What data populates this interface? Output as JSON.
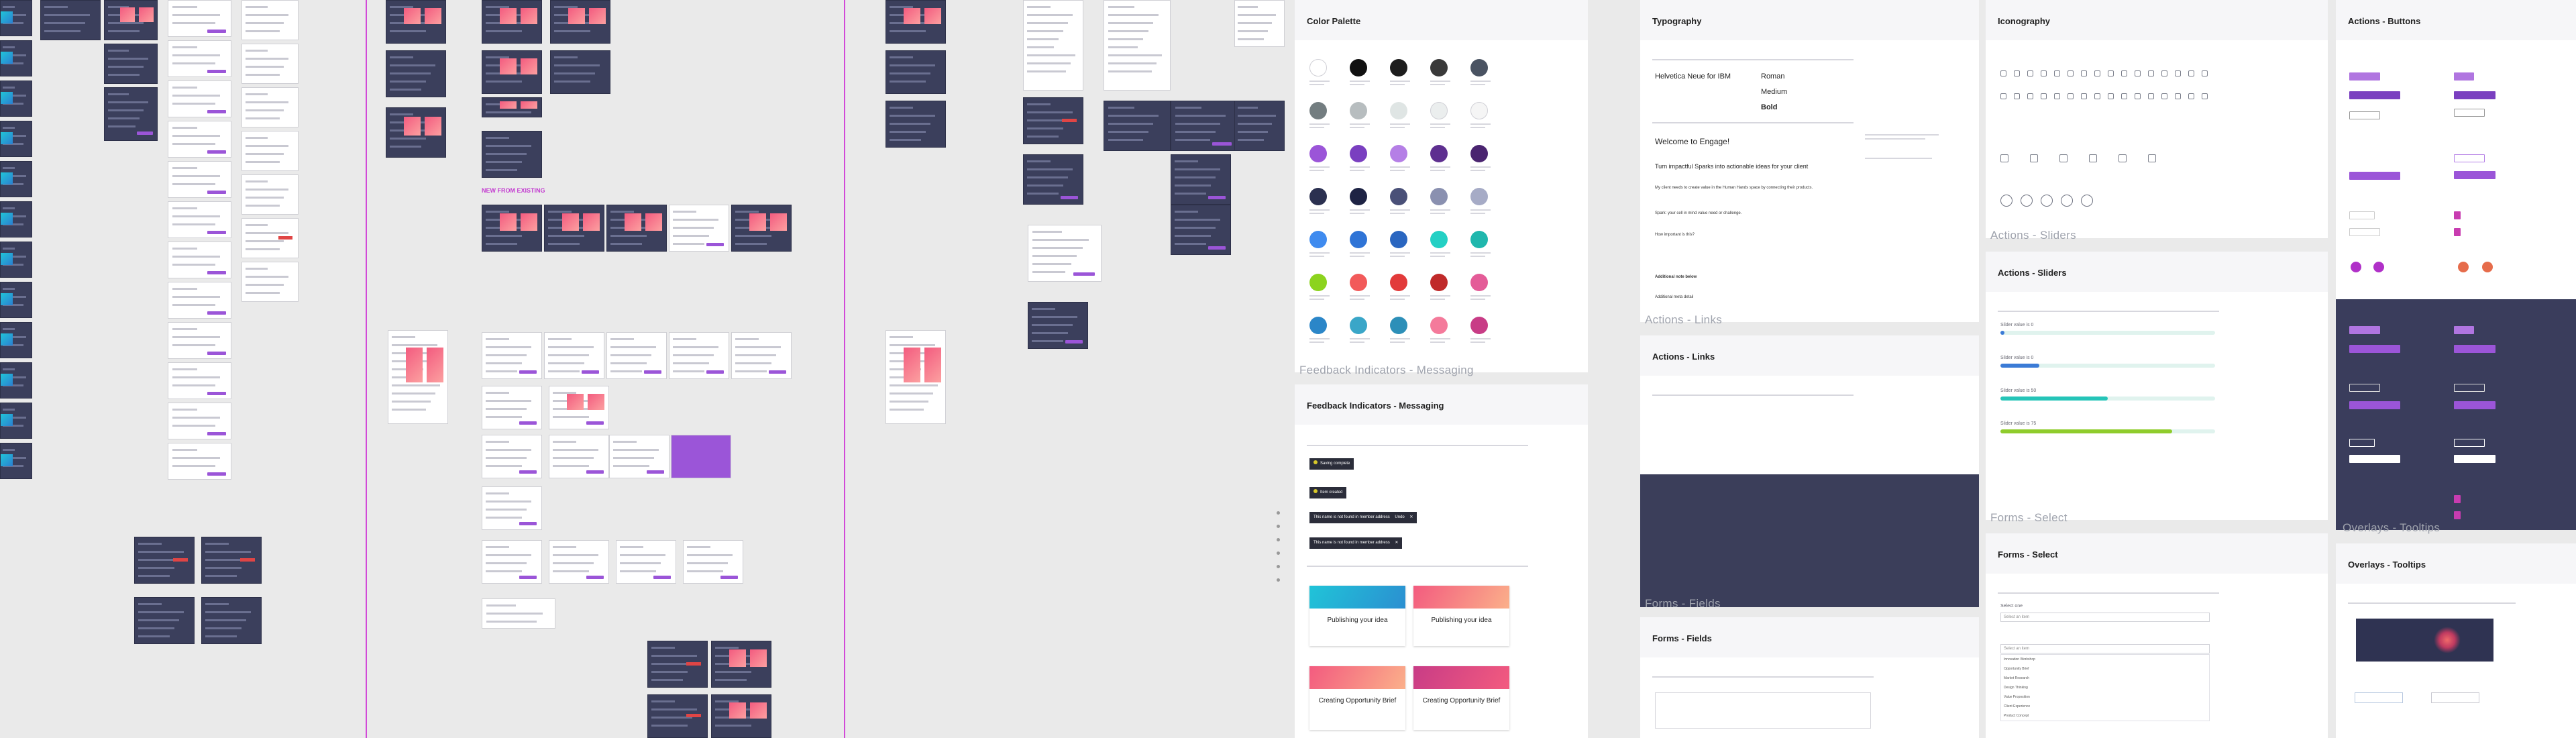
{
  "canvas_labels": {
    "new_from_existing": "NEW FROM EXISTING"
  },
  "captions": {
    "feedback_indicators_messaging": "Feedback Indicators - Messaging",
    "actions_links": "Actions - Links",
    "actions_sliders": "Actions - Sliders",
    "forms_select": "Forms - Select",
    "forms_fields": "Forms - Fields",
    "overlays_tooltips": "Overlays - Tooltips"
  },
  "panels": {
    "color_palette": {
      "title": "Color Palette"
    },
    "typography": {
      "title": "Typography",
      "font_name": "Helvetica Neue for IBM",
      "weights": [
        "Roman",
        "Medium",
        "Bold"
      ],
      "welcome": "Welcome to Engage!",
      "subheading": "Turn impactful Sparks into actionable ideas for your client",
      "body": "My client needs to create value in the Human Hands space by connecting their products.",
      "question": "Spark: your cell in mind value need or challenge.",
      "label_1": "How important is this?",
      "label_2": "Additional note below",
      "label_3": "Additional meta detail"
    },
    "iconography": {
      "title": "Iconography"
    },
    "actions_buttons": {
      "title": "Actions - Buttons"
    },
    "feedback_messaging": {
      "title": "Feedback Indicators - Messaging",
      "toasts": [
        "Saving complete",
        "Item created",
        "This name is not found in member address",
        "This name is not found in member address"
      ],
      "toast_action": "Undo",
      "cards": [
        {
          "title": "Publishing your idea",
          "cover": "cyan"
        },
        {
          "title": "Publishing your idea",
          "cover": "pink"
        },
        {
          "title": "Creating Opportunity Brief",
          "cover": "pink"
        },
        {
          "title": "Creating Opportunity Brief",
          "cover": "magenta"
        }
      ]
    },
    "actions_links": {
      "title": "Actions - Links"
    },
    "actions_sliders": {
      "title": "Actions - Sliders",
      "sliders": [
        {
          "label": "Slider value is 0",
          "value": 0.02,
          "color": "#3b7bd6"
        },
        {
          "label": "Slider value is 0",
          "value": 0.18,
          "color": "#3b7bd6"
        },
        {
          "label": "Slider value is 50",
          "value": 0.5,
          "color": "#25c4b8"
        },
        {
          "label": "Slider value is 75",
          "value": 0.8,
          "color": "#8fcc2c"
        }
      ]
    },
    "forms_select": {
      "title": "Forms - Select",
      "label_1": "Select one",
      "placeholder": "Select an item",
      "options": [
        "Innovation Workshop",
        "Opportunity Brief",
        "Market Research",
        "Design Thinking",
        "Value Proposition",
        "Client Experience",
        "Product Concept"
      ]
    },
    "forms_fields": {
      "title": "Forms - Fields"
    },
    "overlays_tooltips": {
      "title": "Overlays - Tooltips"
    }
  },
  "colors": {
    "guide": "#d24ad8",
    "navy": "#3b3e5a",
    "purple": "#9b55d8",
    "pink": "#f35b7f",
    "cyan": "#20c4d8",
    "palette": [
      "#ffffff",
      "#111111",
      "#1d1d1d",
      "#3a3a3a",
      "#4a5362",
      "#737d80",
      "#b7bdbf",
      "#dfe5e4",
      "#ebeeee",
      "#f5f5f5",
      "#9b55d8",
      "#7a3fc0",
      "#b57fe6",
      "#5e2f90",
      "#4a2470",
      "#2b3050",
      "#1e2344",
      "#4a5078",
      "#8a90b0",
      "#a6abc6",
      "#3f8bef",
      "#2f74d6",
      "#2a66c0",
      "#24d0c4",
      "#20b7ad",
      "#8cd31e",
      "#f25a5a",
      "#e23a3a",
      "#c02a2a",
      "#e45c98",
      "#2b86c8",
      "#3aa6c8",
      "#2d8fb8",
      "#f47a9b",
      "#c83c86"
    ]
  }
}
